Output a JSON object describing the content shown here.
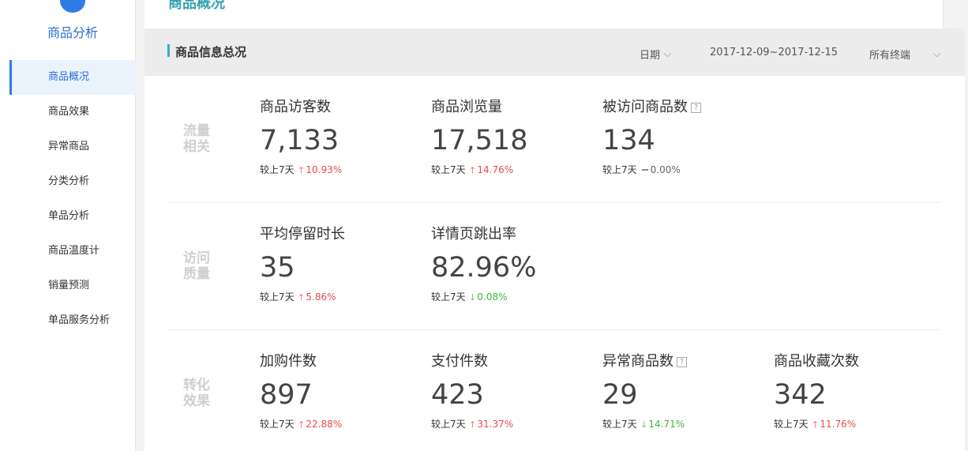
{
  "sidebar": {
    "title": "商品分析",
    "items": [
      {
        "label": "商品概况",
        "active": true
      },
      {
        "label": "商品效果"
      },
      {
        "label": "异常商品"
      },
      {
        "label": "分类分析"
      },
      {
        "label": "单品分析"
      },
      {
        "label": "商品温度计"
      },
      {
        "label": "销量预测"
      },
      {
        "label": "单品服务分析"
      }
    ]
  },
  "header": {
    "page_title": "商品概况"
  },
  "section": {
    "title": "商品信息总况",
    "filters": {
      "date_label": "日期",
      "date_range": "2017-12-09~2017-12-15",
      "terminal": "所有终端"
    }
  },
  "compare_label": "较上7天",
  "colors": {
    "up": "#e84b4b",
    "down": "#3fb53f",
    "accent": "#2eb0c8",
    "brand": "#2f7be5"
  },
  "groups": [
    {
      "label": "流量相关",
      "metrics": [
        {
          "name": "商品访客数",
          "value": "7,133",
          "change": "10.93%",
          "trend": "up"
        },
        {
          "name": "商品浏览量",
          "value": "17,518",
          "change": "14.76%",
          "trend": "up"
        },
        {
          "name": "被访问商品数",
          "value": "134",
          "change": "0.00%",
          "trend": "flat",
          "help": "?"
        }
      ]
    },
    {
      "label": "访问质量",
      "metrics": [
        {
          "name": "平均停留时长",
          "value": "35",
          "change": "5.86%",
          "trend": "up"
        },
        {
          "name": "详情页跳出率",
          "value": "82.96%",
          "change": "0.08%",
          "trend": "down"
        }
      ]
    },
    {
      "label": "转化效果",
      "metrics": [
        {
          "name": "加购件数",
          "value": "897",
          "change": "22.88%",
          "trend": "up"
        },
        {
          "name": "支付件数",
          "value": "423",
          "change": "31.37%",
          "trend": "up"
        },
        {
          "name": "异常商品数",
          "value": "29",
          "change": "14.71%",
          "trend": "down",
          "help": "?"
        },
        {
          "name": "商品收藏次数",
          "value": "342",
          "change": "11.76%",
          "trend": "up"
        }
      ]
    }
  ]
}
